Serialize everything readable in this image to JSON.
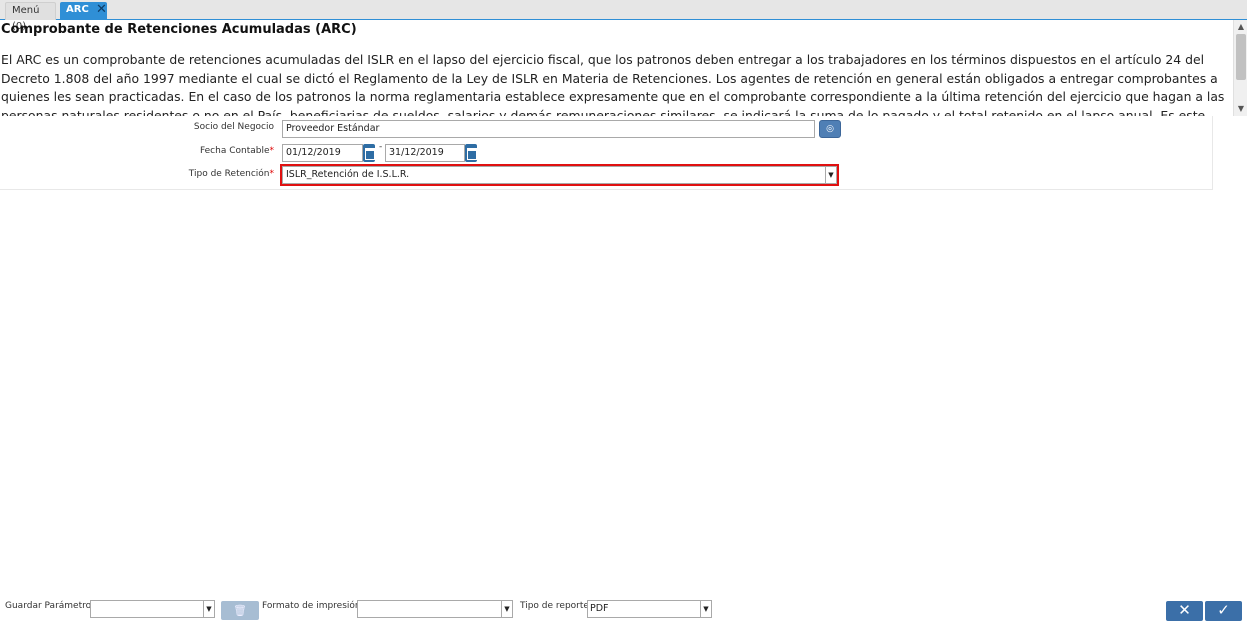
{
  "tabs": {
    "menu_label": "Menú (0)",
    "active_label": "ARC",
    "close_glyph": "✕"
  },
  "description": {
    "title": "Comprobante de Retenciones Acumuladas (ARC)",
    "body": "El ARC es un comprobante de retenciones acumuladas del ISLR en el lapso del ejercicio fiscal, que los patronos deben entregar a los trabajadores en los términos dispuestos en el artículo 24 del Decreto 1.808 del año 1997 mediante el cual se dictó el Reglamento de la Ley de ISLR en Materia de Retenciones. Los agentes de retención en general están obligados a entregar comprobantes a quienes les sean practicadas. En el caso de los patronos la norma reglamentaria establece expresamente que en el comprobante correspondiente a la última retención del ejercicio que hagan a las personas naturales residentes o no en el País, beneficiarias de sueldos, salarios y demás remuneraciones similares, se indicará la suma de lo pagado y el total retenido en el lapso anual. Es este último comprobante de retención al que se le denomina"
  },
  "params": {
    "socio_label": "Socio del Negocio",
    "socio_value": "Proveedor Estándar",
    "fecha_label": "Fecha Contable",
    "required_mark": "*",
    "fecha_from": "01/12/2019",
    "fecha_sep": "-",
    "fecha_to": "31/12/2019",
    "tipo_label": "Tipo de Retención",
    "tipo_value": "ISLR_Retención de I.S.L.R."
  },
  "footer": {
    "guardar_label": "Guardar Parámetro",
    "guardar_value": "",
    "formato_label": "Formato de impresión",
    "formato_value": "",
    "tipo_reporte_label": "Tipo de reporte",
    "tipo_reporte_value": "PDF",
    "cancel_glyph": "✕",
    "ok_glyph": "✓"
  },
  "colors": {
    "accent": "#2f8fd6",
    "highlight": "#e01010",
    "button": "#3b6fa8"
  }
}
